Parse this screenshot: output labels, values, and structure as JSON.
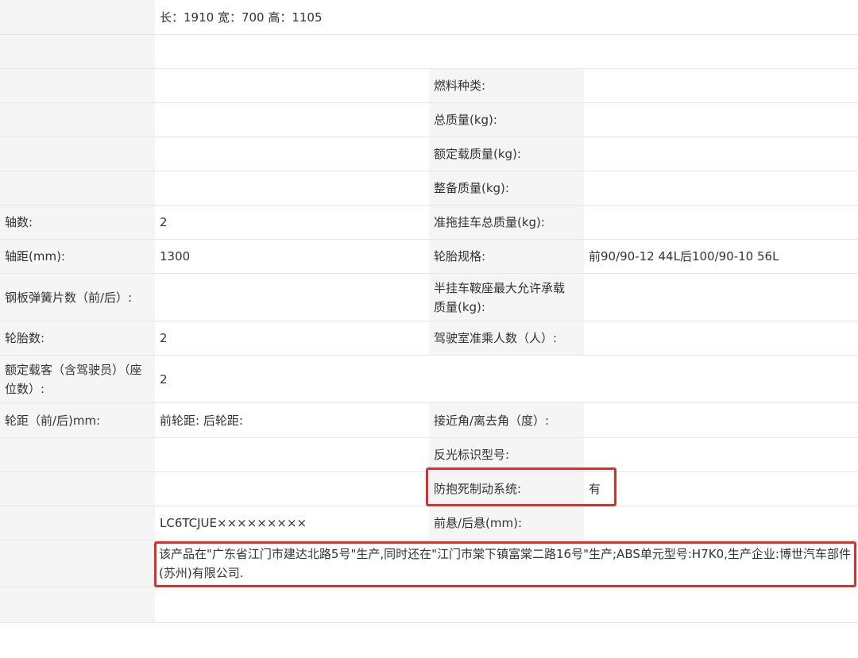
{
  "rows": [
    {
      "c1": "",
      "c2": "长：1910 宽：700 高：1105"
    },
    {
      "c1": "",
      "c2": ""
    },
    {
      "c1": "",
      "c2": "",
      "c3": "燃料种类:",
      "c4": ""
    },
    {
      "c1": "",
      "c2": "",
      "c3": "总质量(kg):",
      "c4": ""
    },
    {
      "c1": "",
      "c2": "",
      "c3": "额定载质量(kg):",
      "c4": ""
    },
    {
      "c1": "",
      "c2": "",
      "c3": "整备质量(kg):",
      "c4": ""
    },
    {
      "c1": "轴数:",
      "c2": "2",
      "c3": "准拖挂车总质量(kg):",
      "c4": ""
    },
    {
      "c1": "轴距(mm):",
      "c2": "1300",
      "c3": "轮胎规格:",
      "c4": "前90/90-12 44L后100/90-10 56L"
    },
    {
      "c1": "钢板弹簧片数（前/后）:",
      "c2": "",
      "c3": "半挂车鞍座最大允许承载质量(kg):",
      "c4": ""
    },
    {
      "c1": "轮胎数:",
      "c2": "2",
      "c3": "驾驶室准乘人数（人）:",
      "c4": ""
    },
    {
      "c1": "额定载客（含驾驶员）（座位数）:",
      "c2": "2"
    },
    {
      "c1": "轮距（前/后)mm:",
      "c2": "前轮距: 后轮距:",
      "c3": "接近角/离去角（度）:",
      "c4": ""
    },
    {
      "c1": "",
      "c2": "",
      "c3": "反光标识型号:",
      "c4": ""
    },
    {
      "c1": "",
      "c2": "",
      "c3": "防抱死制动系统:",
      "c4": "有"
    },
    {
      "c1": "",
      "c2": "LC6TCJUE×××××××××",
      "c3": "前悬/后悬(mm):",
      "c4": ""
    },
    {
      "c1": "",
      "c2": ""
    },
    {
      "c1": "",
      "c2": ""
    }
  ],
  "note": "该产品在\"广东省江门市建达北路5号\"生产,同时还在\"江门市棠下镇富棠二路16号\"生产;ABS单元型号:H7K0,生产企业:博世汽车部件(苏州)有限公司.",
  "colors": {
    "label_bg": "#f5f5f5",
    "value_bg": "#ffffff",
    "highlight": "#d9302c",
    "text": "#333333"
  }
}
